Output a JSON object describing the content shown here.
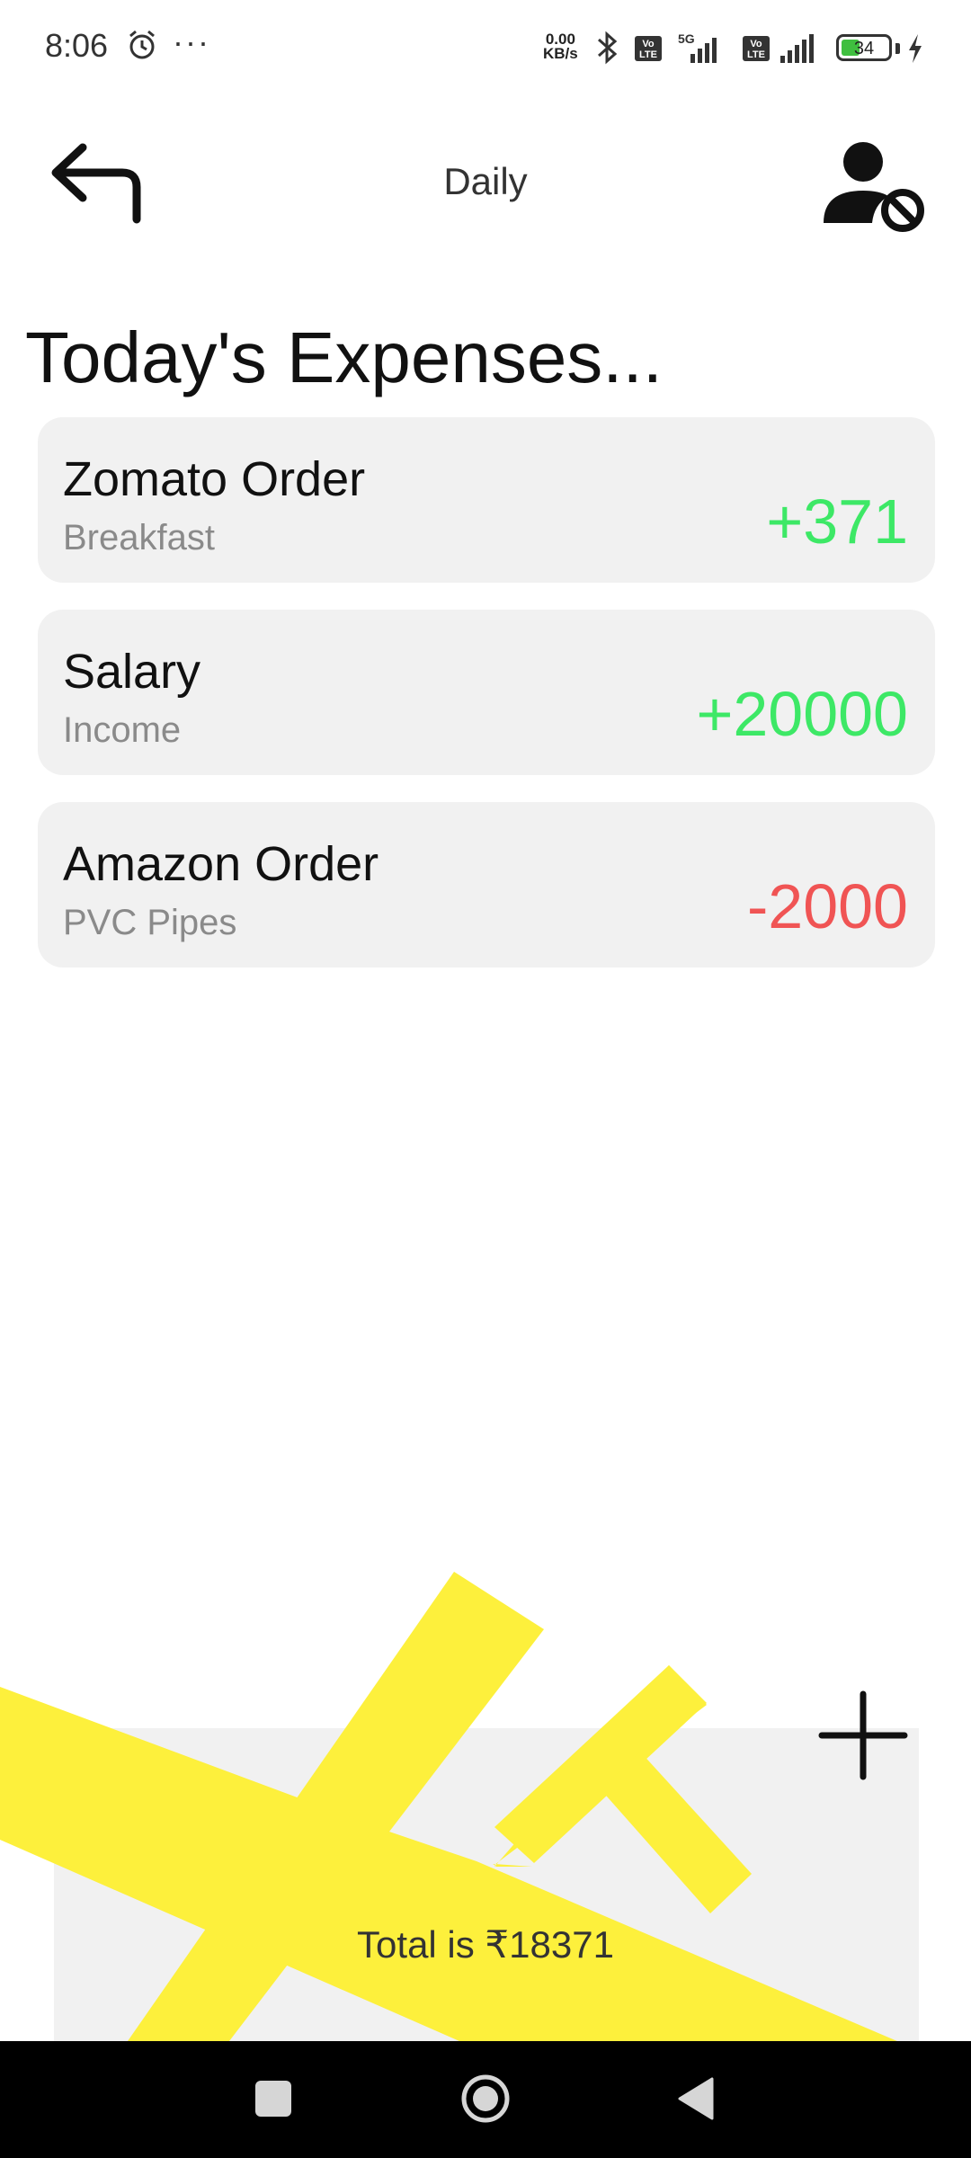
{
  "status_bar": {
    "time": "8:06",
    "network_speed_value": "0.00",
    "network_speed_unit": "KB/s",
    "network_type": "5G",
    "volte_label_1": "Vo",
    "volte_label_2": "LTE",
    "battery_level": "34",
    "icons": [
      "alarm-icon",
      "more-dots-icon",
      "bluetooth-icon",
      "volte-icon",
      "signal-icon",
      "battery-icon",
      "charging-icon"
    ]
  },
  "header": {
    "title": "Daily",
    "back_icon": "back-arrow-icon",
    "profile_icon": "user-block-icon"
  },
  "section_title": "Today's Expenses...",
  "expenses": [
    {
      "title": "Zomato Order",
      "subtitle": "Breakfast",
      "amount": "+371",
      "type": "income"
    },
    {
      "title": "Salary",
      "subtitle": "Income",
      "amount": "+20000",
      "type": "income"
    },
    {
      "title": "Amazon Order",
      "subtitle": "PVC Pipes",
      "amount": "-2000",
      "type": "expense"
    }
  ],
  "colors": {
    "positive": "#3de866",
    "negative": "#f05454",
    "accent_yellow": "#fdf03c",
    "card_bg": "#f1f1f1"
  },
  "footer": {
    "total_label": "Total is ₹18371",
    "add_icon": "plus-icon"
  },
  "nav_bar": {
    "icons": [
      "recents-square-icon",
      "home-circle-icon",
      "back-triangle-icon"
    ]
  }
}
